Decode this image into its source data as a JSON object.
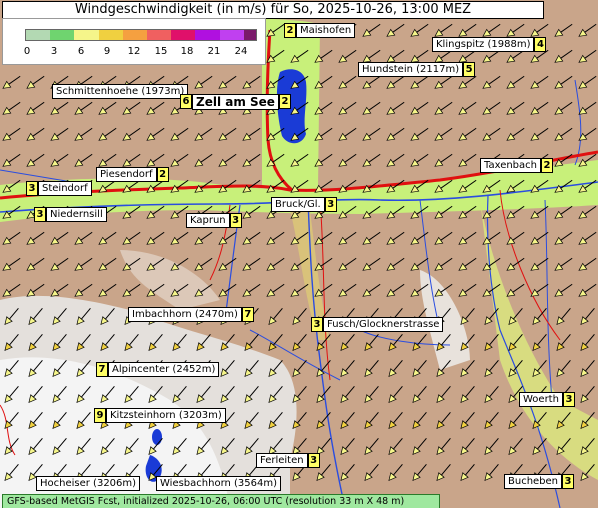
{
  "title": "Windgeschwindigkeit (in m/s) für So, 2025-10-26, 13:00 MEZ",
  "legend": {
    "ticks": [
      "0",
      "3",
      "6",
      "9",
      "12",
      "15",
      "18",
      "21",
      "24"
    ],
    "colors": [
      "#b3d9b3",
      "#6fd46f",
      "#f5f58a",
      "#f0d040",
      "#f5a040",
      "#f06060",
      "#e0106a",
      "#b010e0",
      "#c040f0",
      "#7a1a6a"
    ]
  },
  "places": [
    {
      "name": "Maishofen",
      "value": "2",
      "order": "vn"
    },
    {
      "name": "Klingspitz (1988m)",
      "value": "4",
      "order": "nv"
    },
    {
      "name": "Hundstein (2117m)",
      "value": "5",
      "order": "nv"
    },
    {
      "name": "Schmittenhoehe (1973m)",
      "value": "",
      "order": "n"
    },
    {
      "name": "Zell am See",
      "value": "2",
      "order": "nv",
      "big": true,
      "pre": "6"
    },
    {
      "name": "Piesendorf",
      "value": "2",
      "order": "nv"
    },
    {
      "name": "Taxenbach",
      "value": "2",
      "order": "nv"
    },
    {
      "name": "Steindorf",
      "value": "3",
      "order": "vn"
    },
    {
      "name": "Bruck/Gl.",
      "value": "3",
      "order": "nv"
    },
    {
      "name": "Niedernsill",
      "value": "3",
      "order": "vn"
    },
    {
      "name": "Kaprun",
      "value": "3",
      "order": "nv"
    },
    {
      "name": "Imbachhorn (2470m)",
      "value": "7",
      "order": "nv"
    },
    {
      "name": "Fusch/Glocknerstrasse",
      "value": "3",
      "order": "vn"
    },
    {
      "name": "Alpincenter (2452m)",
      "value": "7",
      "order": "vn"
    },
    {
      "name": "Kitzsteinhorn (3203m)",
      "value": "9",
      "order": "vn"
    },
    {
      "name": "Woerth",
      "value": "3",
      "order": "nv"
    },
    {
      "name": "Ferleiten",
      "value": "3",
      "order": "nv"
    },
    {
      "name": "Hocheiser (3206m)",
      "value": "",
      "order": "n"
    },
    {
      "name": "Wiesbachhorn (3564m)",
      "value": "",
      "order": "n"
    },
    {
      "name": "Bucheben",
      "value": "3",
      "order": "nv"
    }
  ],
  "footer": "GFS-based MetGIS Fcst, initialized 2025-10-26, 06:00 UTC  (resolution 33 m X 48 m)"
}
